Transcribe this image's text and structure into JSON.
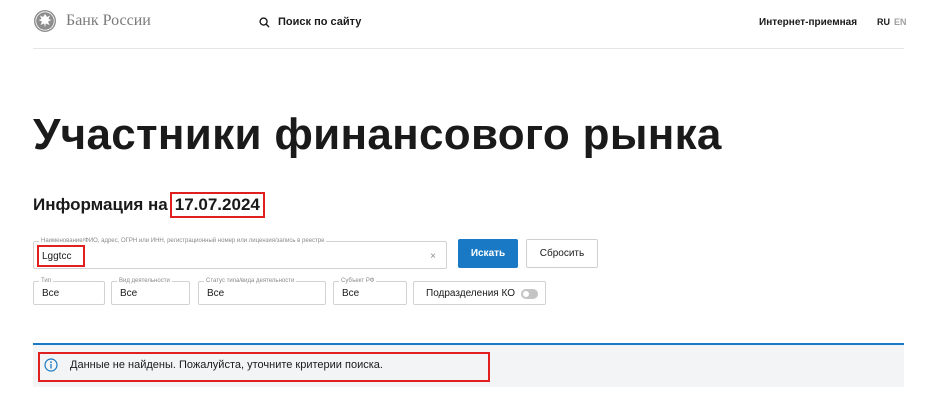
{
  "header": {
    "logo_text": "Банк России",
    "search_label": "Поиск по сайту",
    "reception_link": "Интернет-приемная",
    "lang_ru": "RU",
    "lang_en": "EN"
  },
  "page": {
    "title": "Участники финансового рынка",
    "info_prefix": "Информация на",
    "info_date": "17.07.2024"
  },
  "search_form": {
    "main_field": {
      "label": "Наименование/ФИО, адрес, ОГРН или ИНН, регистрационный номер или лицензия/запись в реестре",
      "value": "Lggtcc",
      "clear_icon": "×"
    },
    "search_button": "Искать",
    "reset_button": "Сбросить",
    "filters": [
      {
        "label": "Тип",
        "value": "Все"
      },
      {
        "label": "Вид деятельности",
        "value": "Все"
      },
      {
        "label": "Статус типа/вида деятельности",
        "value": "Все"
      },
      {
        "label": "Субъект РФ",
        "value": "Все"
      }
    ],
    "branches_toggle": {
      "label": "Подразделения КО",
      "state": "off"
    }
  },
  "result": {
    "icon": "info-icon",
    "message": "Данные не найдены. Пожалуйста, уточните критерии поиска."
  },
  "colors": {
    "accent": "#1a79c4",
    "highlight": "#e0201e",
    "panel_bg": "#f2f4f5"
  }
}
